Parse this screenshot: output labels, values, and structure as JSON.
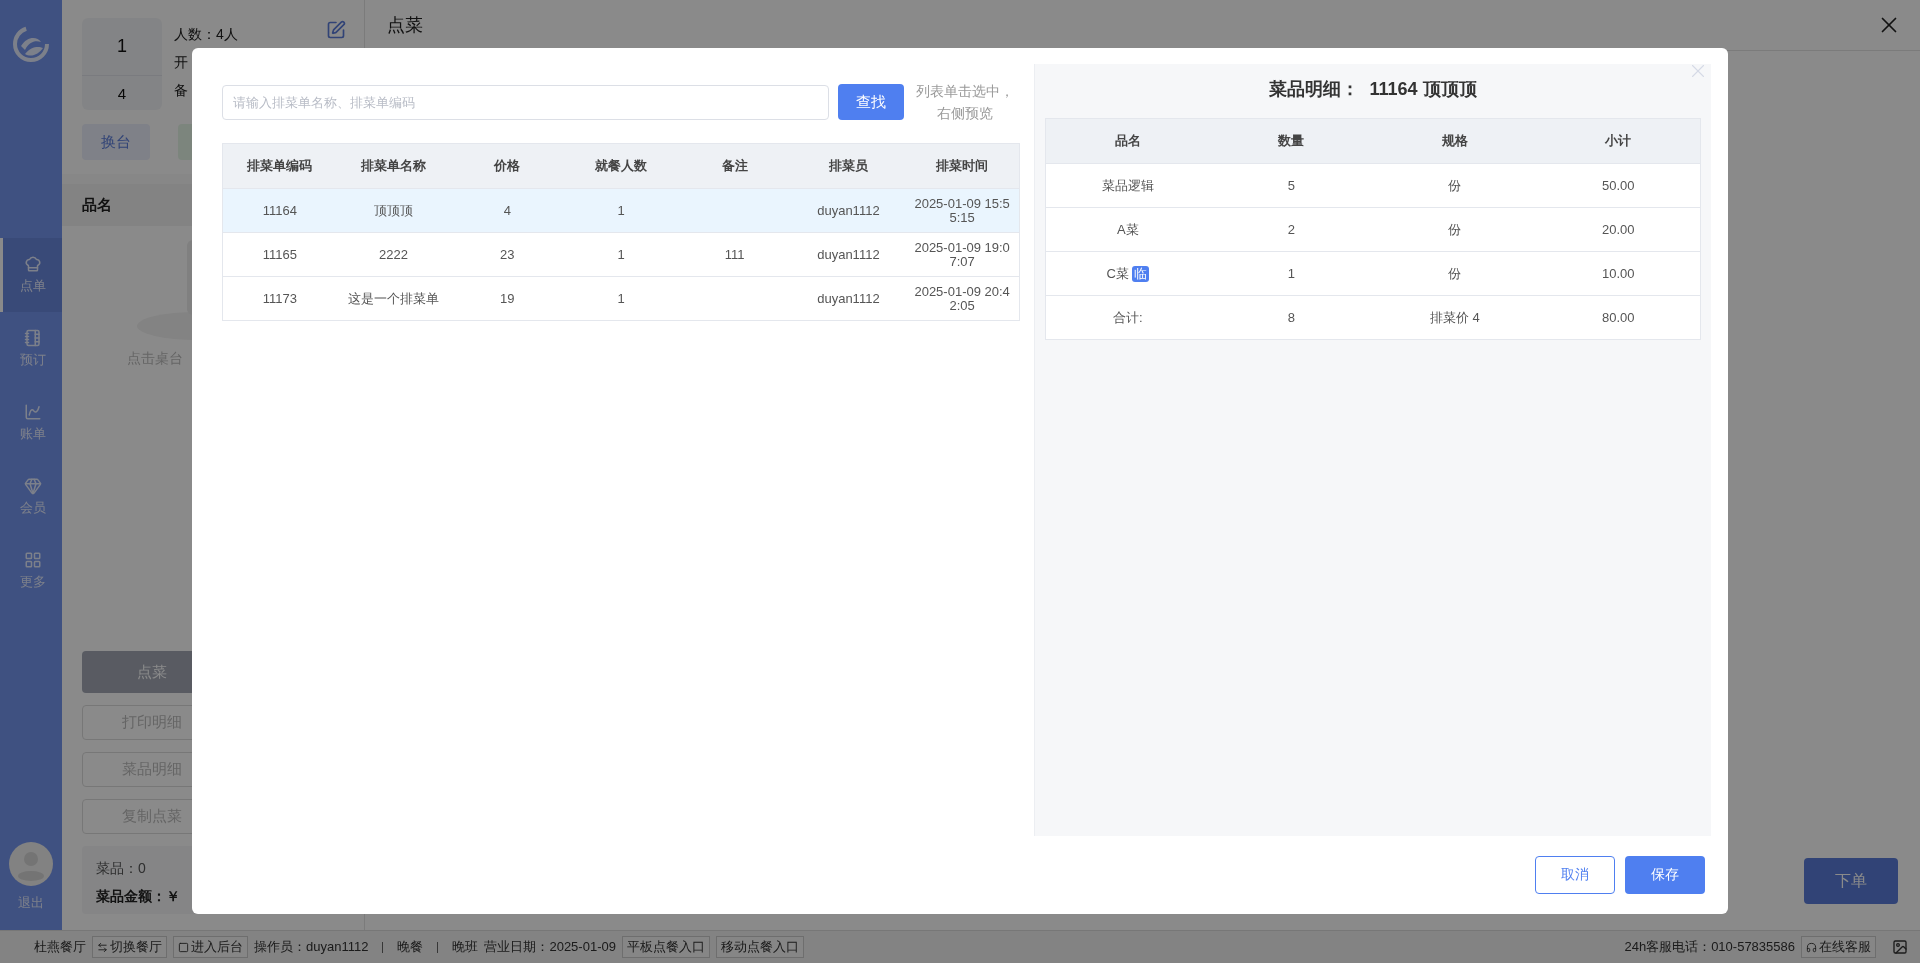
{
  "sidebar": {
    "items": [
      {
        "label": "点单",
        "selected": true
      },
      {
        "label": "预订",
        "selected": false
      },
      {
        "label": "账单",
        "selected": false
      },
      {
        "label": "会员",
        "selected": false
      },
      {
        "label": "更多",
        "selected": false
      }
    ],
    "logout": "退出"
  },
  "table_card": {
    "number": "1",
    "seats": "4",
    "people": "人数：4人",
    "open_time": "开",
    "note": "备"
  },
  "left_panel": {
    "switch_button": "换台",
    "list_header": "品名",
    "empty_text": "点击桌台",
    "order_button": "点菜",
    "actions": [
      "打印明细",
      "菜品明细",
      "复制点菜"
    ],
    "summary": {
      "count": "菜品：0",
      "amount": "菜品金额：￥"
    }
  },
  "main": {
    "title": "点菜",
    "submit_button": "下单"
  },
  "status_bar": {
    "restaurant": "杜燕餐厅",
    "switch": "切换餐厅",
    "backend": "进入后台",
    "operator": "操作员：duyan1112",
    "meal": "晚餐",
    "shift": "晚班",
    "business_date": "营业日期：2025-01-09",
    "entries": [
      "平板点餐入口",
      "移动点餐入口"
    ],
    "hotline": "24h客服电话：010-57835586",
    "support": "在线客服"
  },
  "dialog": {
    "search": {
      "placeholder": "请输入排菜单名称、排菜单编码",
      "button": "查找",
      "hint": "列表单击选中，右侧预览"
    },
    "list": {
      "columns": [
        "排菜单编码",
        "排菜单名称",
        "价格",
        "就餐人数",
        "备注",
        "排菜员",
        "排菜时间"
      ],
      "rows": [
        {
          "cells": [
            "11164",
            "顶顶顶",
            "4",
            "1",
            "",
            "duyan1112",
            "2025-01-09 15:55:15"
          ],
          "selected": true
        },
        {
          "cells": [
            "11165",
            "2222",
            "23",
            "1",
            "111",
            "duyan1112",
            "2025-01-09 19:07:07"
          ],
          "selected": false
        },
        {
          "cells": [
            "11173",
            "这是一个排菜单",
            "19",
            "1",
            "",
            "duyan1112",
            "2025-01-09 20:42:05"
          ],
          "selected": false
        }
      ]
    },
    "detail": {
      "title": "菜品明细：  11164 顶顶顶",
      "columns": [
        "品名",
        "数量",
        "规格",
        "小计"
      ],
      "rows": [
        {
          "name": "菜品逻辑",
          "qty": "5",
          "unit": "份",
          "subtotal": "50.00"
        },
        {
          "name": "A菜",
          "qty": "2",
          "unit": "份",
          "subtotal": "20.00"
        },
        {
          "name": "C菜",
          "tag": "临",
          "qty": "1",
          "unit": "份",
          "subtotal": "10.00"
        }
      ],
      "total": {
        "name": "合计:",
        "qty": "8",
        "unit": "排菜价 4",
        "subtotal": "80.00"
      }
    },
    "buttons": {
      "cancel": "取消",
      "save": "保存"
    }
  }
}
